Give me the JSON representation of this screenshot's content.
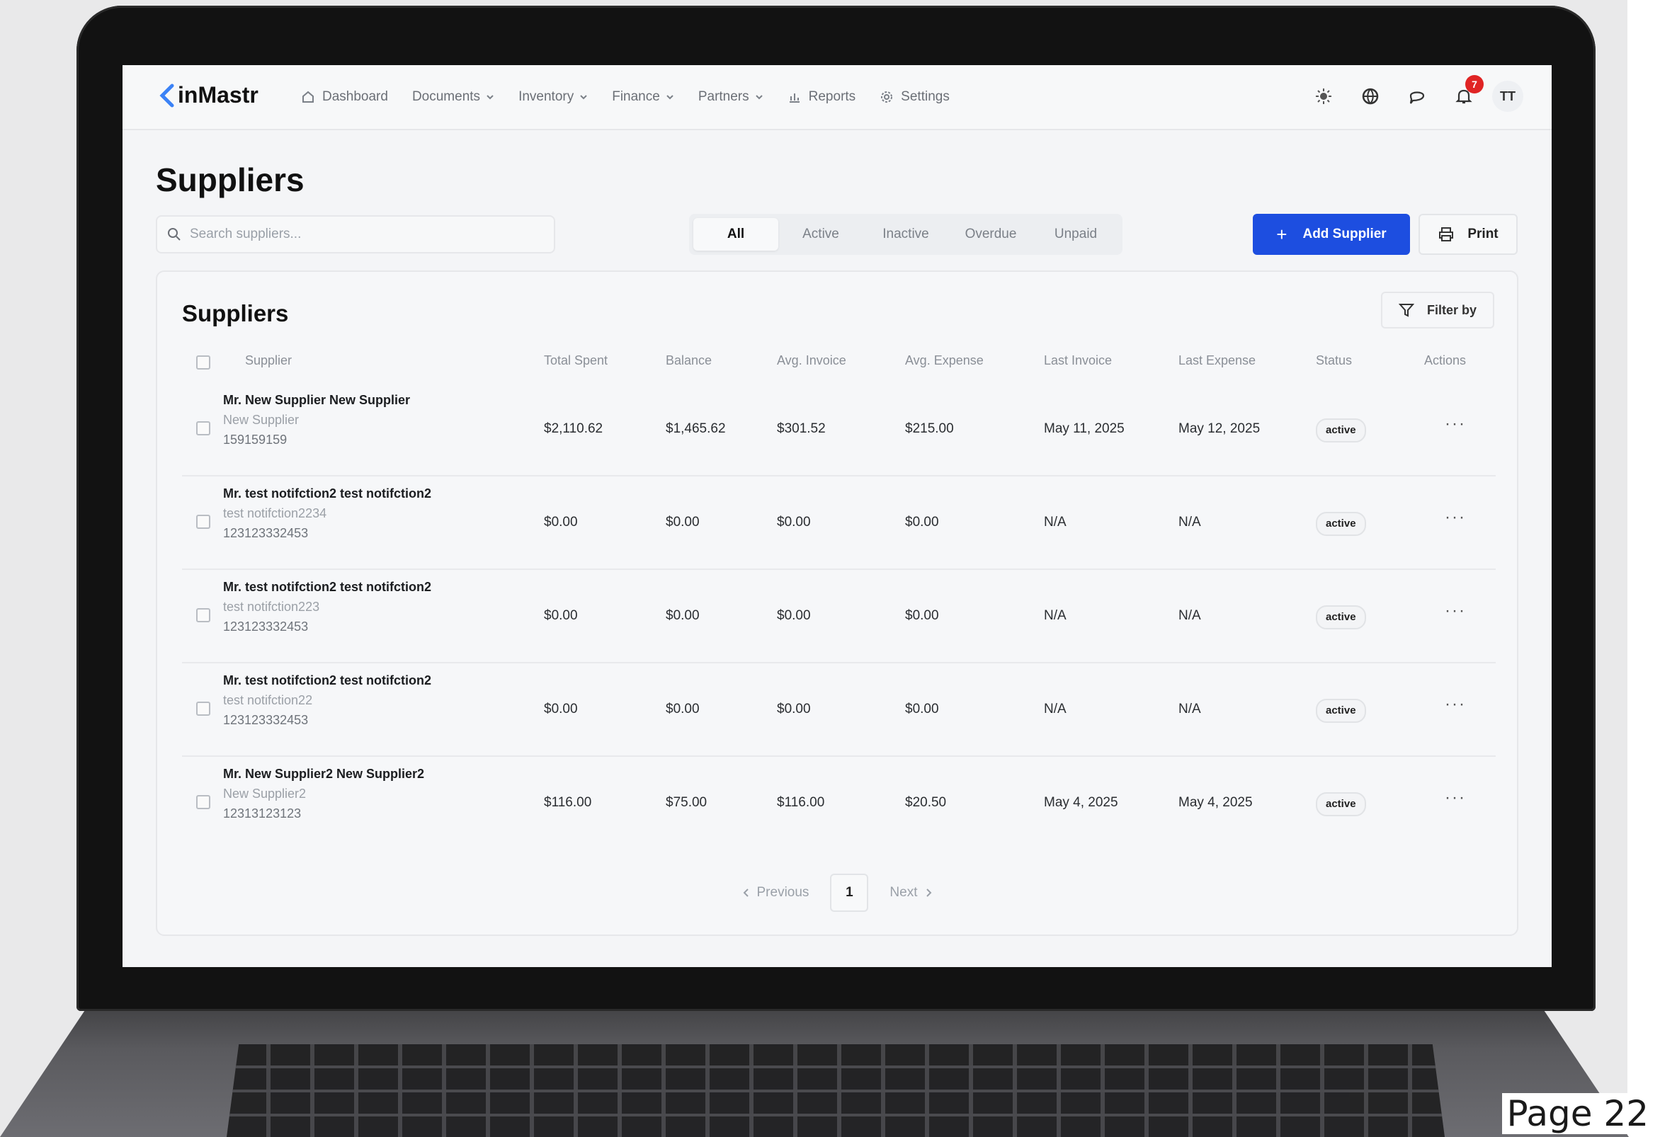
{
  "app": {
    "logo_text": "inMastr",
    "page_label": "Page 22"
  },
  "nav": {
    "items": [
      {
        "label": "Dashboard",
        "icon": "home-icon",
        "dropdown": false
      },
      {
        "label": "Documents",
        "dropdown": true
      },
      {
        "label": "Inventory",
        "dropdown": true
      },
      {
        "label": "Finance",
        "dropdown": true
      },
      {
        "label": "Partners",
        "dropdown": true
      },
      {
        "label": "Reports",
        "icon": "bar-chart-icon",
        "dropdown": false
      },
      {
        "label": "Settings",
        "icon": "gear-icon",
        "dropdown": false
      }
    ],
    "right_icons": [
      "sun-icon",
      "globe-icon",
      "chat-icon",
      "bell-icon"
    ],
    "notification_count": "7",
    "avatar_initials": "TT"
  },
  "page": {
    "title": "Suppliers"
  },
  "search": {
    "placeholder": "Search suppliers..."
  },
  "tabs": [
    {
      "label": "All",
      "active": true
    },
    {
      "label": "Active",
      "active": false
    },
    {
      "label": "Inactive",
      "active": false
    },
    {
      "label": "Overdue",
      "active": false
    },
    {
      "label": "Unpaid",
      "active": false
    }
  ],
  "buttons": {
    "add_supplier": "Add Supplier",
    "print": "Print",
    "filter_by": "Filter by"
  },
  "card": {
    "title": "Suppliers"
  },
  "table": {
    "columns": [
      "Supplier",
      "Total Spent",
      "Balance",
      "Avg. Invoice",
      "Avg. Expense",
      "Last Invoice",
      "Last Expense",
      "Status",
      "Actions"
    ],
    "rows": [
      {
        "name": "Mr. New Supplier New Supplier",
        "company": "New Supplier",
        "phone": "159159159",
        "total_spent": "$2,110.62",
        "balance": "$1,465.62",
        "avg_invoice": "$301.52",
        "avg_expense": "$215.00",
        "last_invoice": "May 11, 2025",
        "last_expense": "May 12, 2025",
        "status": "active"
      },
      {
        "name": "Mr. test notifction2 test notifction2",
        "company": "test notifction2234",
        "phone": "123123332453",
        "total_spent": "$0.00",
        "balance": "$0.00",
        "avg_invoice": "$0.00",
        "avg_expense": "$0.00",
        "last_invoice": "N/A",
        "last_expense": "N/A",
        "status": "active"
      },
      {
        "name": "Mr. test notifction2 test notifction2",
        "company": "test notifction223",
        "phone": "123123332453",
        "total_spent": "$0.00",
        "balance": "$0.00",
        "avg_invoice": "$0.00",
        "avg_expense": "$0.00",
        "last_invoice": "N/A",
        "last_expense": "N/A",
        "status": "active"
      },
      {
        "name": "Mr. test notifction2 test notifction2",
        "company": "test notifction22",
        "phone": "123123332453",
        "total_spent": "$0.00",
        "balance": "$0.00",
        "avg_invoice": "$0.00",
        "avg_expense": "$0.00",
        "last_invoice": "N/A",
        "last_expense": "N/A",
        "status": "active"
      },
      {
        "name": "Mr. New Supplier2 New Supplier2",
        "company": "New Supplier2",
        "phone": "12313123123",
        "total_spent": "$116.00",
        "balance": "$75.00",
        "avg_invoice": "$116.00",
        "avg_expense": "$20.50",
        "last_invoice": "May 4, 2025",
        "last_expense": "May 4, 2025",
        "status": "active"
      }
    ],
    "actions_glyph": "···"
  },
  "pagination": {
    "previous": "Previous",
    "current_page": "1",
    "next": "Next"
  },
  "colors": {
    "primary": "#1d4ee0",
    "badge": "#e02424"
  }
}
